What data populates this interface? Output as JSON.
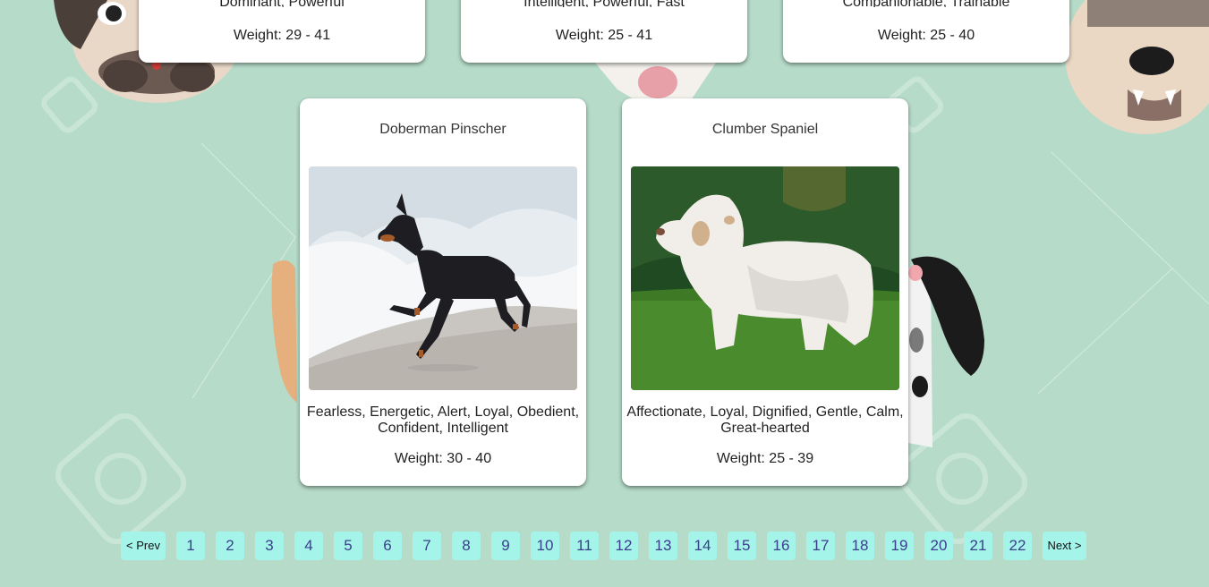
{
  "top_cards": [
    {
      "temperament": "Dominant, Powerful",
      "weight": "Weight: 29 - 41"
    },
    {
      "temperament": "Intelligent, Powerful, Fast",
      "weight": "Weight: 25 - 41"
    },
    {
      "temperament": "Companionable, Trainable",
      "weight": "Weight: 25 - 40"
    }
  ],
  "cards": [
    {
      "name": "Doberman Pinscher",
      "temperament": "Fearless, Energetic, Alert, Loyal, Obedient, Confident, Intelligent",
      "weight": "Weight: 30 - 40",
      "image": "black-tan-dog-on-beach-photo"
    },
    {
      "name": "Clumber Spaniel",
      "temperament": "Affectionate, Loyal, Dignified, Gentle, Calm, Great-hearted",
      "weight": "Weight: 25 - 39",
      "image": "white-spaniel-on-grass-photo"
    }
  ],
  "pagination": {
    "prev_label": "< Prev",
    "next_label": "Next >",
    "pages": [
      "1",
      "2",
      "3",
      "4",
      "5",
      "6",
      "7",
      "8",
      "9",
      "10",
      "11",
      "12",
      "13",
      "14",
      "15",
      "16",
      "17",
      "18",
      "19",
      "20",
      "21",
      "22"
    ]
  },
  "colors": {
    "background": "#b6dbc9",
    "card": "#ffffff",
    "page_button": "#a4f4ea",
    "page_number_text": "#3a3f8a"
  }
}
